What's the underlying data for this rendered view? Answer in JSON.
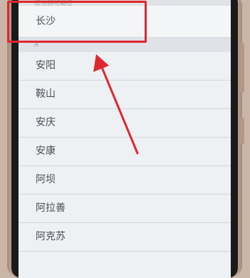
{
  "location": {
    "section_label": "您当前可能在",
    "current_city": "长沙"
  },
  "list": {
    "section_a_label": "A",
    "cities": [
      "安阳",
      "鞍山",
      "安庆",
      "安康",
      "阿坝",
      "阿拉善",
      "阿克苏"
    ]
  },
  "colors": {
    "highlight": "#e0262f",
    "arrow": "#e0262f",
    "screen_bg": "#eef1f4",
    "header_bg": "#dfe2e6"
  }
}
